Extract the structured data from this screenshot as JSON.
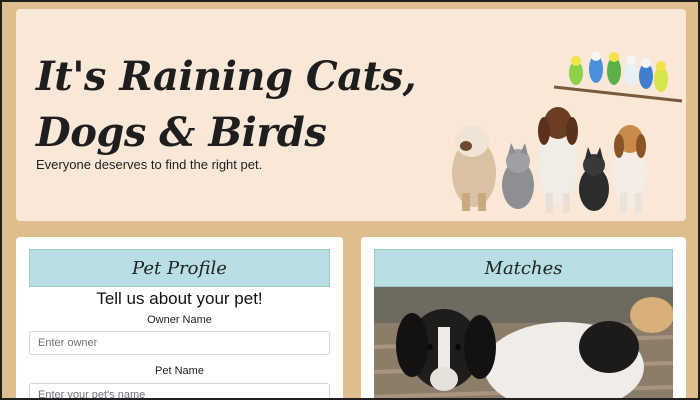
{
  "hero": {
    "title": "It's Raining Cats, Dogs & Birds",
    "subtitle": "Everyone deserves to find the right pet."
  },
  "profile": {
    "header": "Pet Profile",
    "form_title": "Tell us about your pet!",
    "owner_label": "Owner Name",
    "owner_placeholder": "Enter owner",
    "pet_label": "Pet Name",
    "pet_placeholder": "Enter your pet's name"
  },
  "matches": {
    "header": "Matches"
  },
  "colors": {
    "page_bg": "#dfbd8f",
    "hero_bg": "#f9e8d8",
    "card_header_bg": "#b7dfe4"
  }
}
